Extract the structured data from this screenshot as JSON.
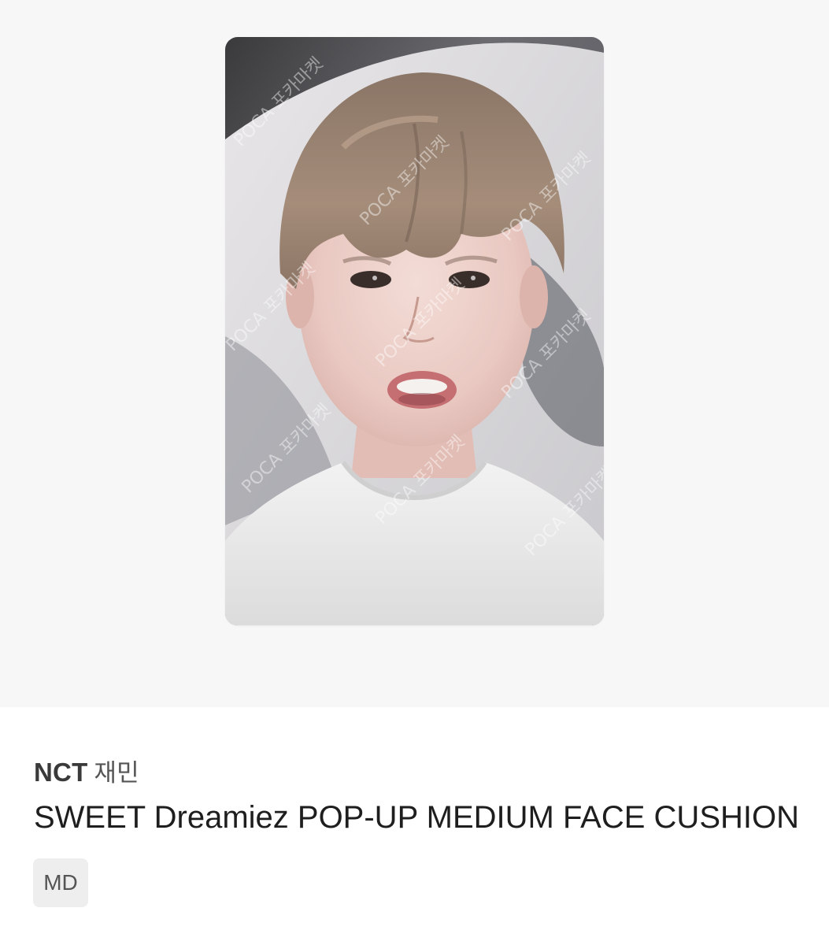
{
  "product": {
    "image_alt": "NCT Jaemin photocard",
    "watermark_text": "POCA 포카마켓",
    "group": "NCT",
    "member": "재민",
    "title": "SWEET Dreamiez POP-UP MEDIUM FACE CUSHION",
    "category_badge": "MD"
  },
  "colors": {
    "image_background": "#f7f7f7",
    "title_text": "#1e1e1e",
    "badge_background": "#eeeeee"
  }
}
